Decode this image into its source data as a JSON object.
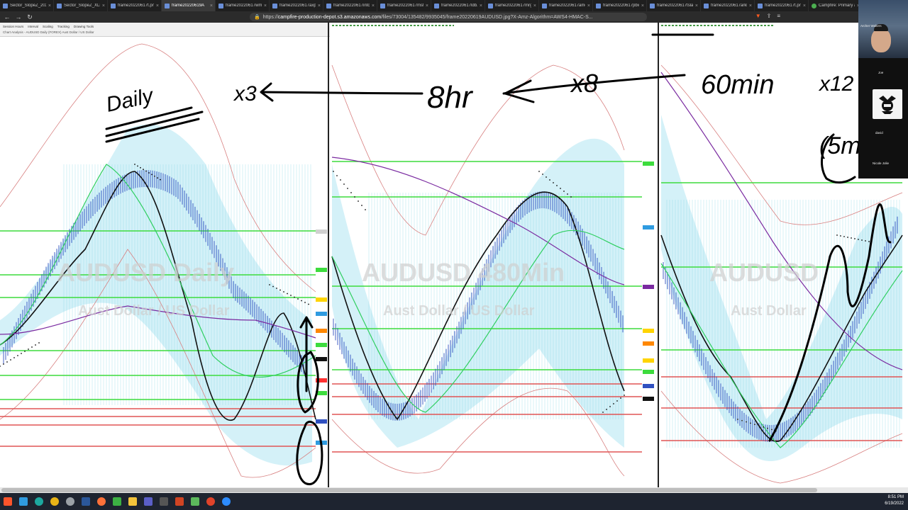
{
  "browser": {
    "tabs": [
      {
        "label": "Sector_SlopeZ_2022060",
        "active": false
      },
      {
        "label": "Sector_SlopeZ_XLF_X",
        "active": false
      },
      {
        "label": "frame20220617t.png",
        "active": false
      },
      {
        "label": "frame20220619A",
        "active": true
      },
      {
        "label": "frame20220617wmt",
        "active": false
      },
      {
        "label": "frame20220617axp.p",
        "active": false
      },
      {
        "label": "frame20220617intc",
        "active": false
      },
      {
        "label": "frame20220617msft",
        "active": false
      },
      {
        "label": "frame20220617ldb.pn",
        "active": false
      },
      {
        "label": "frame20220617mrg.p",
        "active": false
      },
      {
        "label": "frame20220617amd",
        "active": false
      },
      {
        "label": "frame20220617pbw.p",
        "active": false
      },
      {
        "label": "frame20220617tsla.p",
        "active": false
      },
      {
        "label": "frame20220617arkk",
        "active": false
      },
      {
        "label": "frame20220617t.png",
        "active": false
      },
      {
        "label": "Campfire: Primary an",
        "active": false
      }
    ],
    "url_prefix": "https://",
    "url_host": "campfire-production-depot.s3.amazonaws.com",
    "url_path": "/files/73004/135482/9935045/frame20220619AUDUSD.jpg?X-Amz-Algorithm=AWS4-HMAC-S..."
  },
  "chart_app": {
    "menu": [
      "Session Hours",
      "Interval",
      "Scaling",
      "Tracking",
      "Drawing Tools"
    ],
    "header": "Chart Analysis - AUDUSD Daily (FOREX) Aust Dollar / US Dollar"
  },
  "panels": [
    {
      "watermark_symbol": "AUDUSD Daily",
      "watermark_desc": "Aust Dollar / US Dollar"
    },
    {
      "watermark_symbol": "AUDUSD 480Min",
      "watermark_desc": "Aust Dollar / US Dollar"
    },
    {
      "watermark_symbol": "AUDUSD",
      "watermark_desc": "Aust Dollar"
    }
  ],
  "annotations": {
    "daily": "Daily",
    "x3": "x3",
    "hr8": "8hr",
    "x8": "x8",
    "min60": "60min",
    "x12": "x12",
    "m5": "(5m"
  },
  "video": {
    "participants": [
      "Archer Walters",
      "Joe",
      "david",
      "Nicole Jolie"
    ]
  },
  "taskbar": {
    "time": "8:51 PM",
    "date": "6/19/2022"
  },
  "colors": {
    "green_level": "#3ddc3d",
    "red_level": "#e05555",
    "cloud": "#9fe0f0",
    "black_line": "#111111",
    "purple_line": "#7a2aa0"
  }
}
